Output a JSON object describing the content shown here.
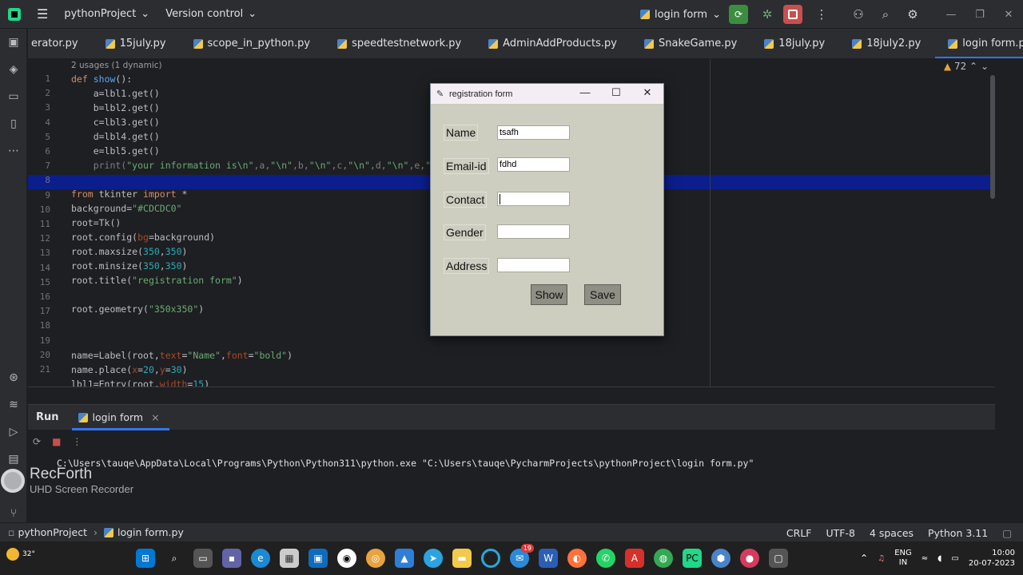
{
  "titlebar": {
    "project": "pythonProject",
    "vcs": "Version control",
    "run_config": "login form"
  },
  "tabs": [
    {
      "label": "erator.py",
      "active": false
    },
    {
      "label": "15july.py",
      "active": false
    },
    {
      "label": "scope_in_python.py",
      "active": false
    },
    {
      "label": "speedtestnetwork.py",
      "active": false
    },
    {
      "label": "AdminAddProducts.py",
      "active": false
    },
    {
      "label": "SnakeGame.py",
      "active": false
    },
    {
      "label": "18july.py",
      "active": false
    },
    {
      "label": "18july2.py",
      "active": false
    },
    {
      "label": "login form.py",
      "active": true
    }
  ],
  "editor": {
    "usage_hint": "2 usages (1 dynamic)",
    "inspection_count": "72",
    "line_numbers": [
      "1",
      "2",
      "3",
      "4",
      "5",
      "6",
      "7",
      "8",
      "9",
      "10",
      "11",
      "12",
      "13",
      "14",
      "15",
      "16",
      "17",
      "18",
      "19",
      "20",
      "21"
    ]
  },
  "tk_window": {
    "title": "registration form",
    "fields": [
      {
        "label": "Name",
        "value": "tsafh"
      },
      {
        "label": "Email-id",
        "value": "fdhd"
      },
      {
        "label": "Contact",
        "value": ""
      },
      {
        "label": "Gender",
        "value": ""
      },
      {
        "label": "Address",
        "value": ""
      }
    ],
    "buttons": {
      "show": "Show",
      "save": "Save"
    },
    "bg_color": "#CDCDC0"
  },
  "run_panel": {
    "title": "Run",
    "tab": "login form",
    "command": "C:\\Users\\tauqe\\AppData\\Local\\Programs\\Python\\Python311\\python.exe \"C:\\Users\\tauqe\\PycharmProjects\\pythonProject\\login form.py\""
  },
  "watermark": {
    "name": "RecForth",
    "sub": "UHD Screen Recorder"
  },
  "statusbar": {
    "project": "pythonProject",
    "file": "login form.py",
    "line_sep": "CRLF",
    "encoding": "UTF-8",
    "indent": "4 spaces",
    "interpreter": "Python 3.11"
  },
  "taskbar": {
    "temp": "32°",
    "lang": "ENG",
    "region": "IN",
    "time": "10:00",
    "date": "20-07-2023",
    "badge": "19"
  },
  "colors": {
    "accent": "#3574f0",
    "highlight_line": "#0b1e8c",
    "run_green": "#3c8d40",
    "stop_red": "#c94f4f"
  }
}
